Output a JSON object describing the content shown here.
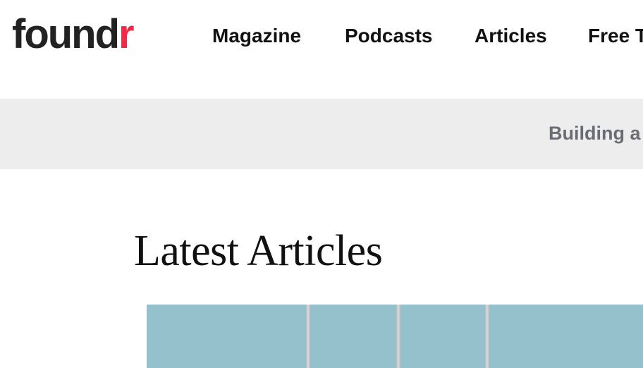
{
  "header": {
    "logo": {
      "main": "found",
      "accent": "r"
    },
    "nav": [
      "Magazine",
      "Podcasts",
      "Articles",
      "Free T"
    ]
  },
  "banner": {
    "text": "Building a"
  },
  "main": {
    "title": "Latest Articles"
  },
  "colors": {
    "logo_accent": "#ed2a4a",
    "banner_bg": "#ededed",
    "thumbnail_bg": "#94c1cb"
  }
}
